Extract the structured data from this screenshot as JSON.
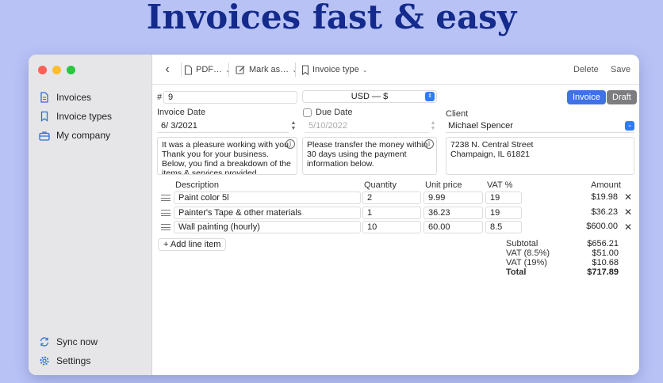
{
  "headline": "Invoices fast & easy",
  "sidebar": {
    "items": [
      {
        "label": "Invoices",
        "icon": "document-icon"
      },
      {
        "label": "Invoice types",
        "icon": "bookmark-icon"
      },
      {
        "label": "My company",
        "icon": "briefcase-icon"
      }
    ],
    "bottom": [
      {
        "label": "Sync now",
        "icon": "sync-icon"
      },
      {
        "label": "Settings",
        "icon": "gear-icon"
      }
    ]
  },
  "toolbar": {
    "pdf_label": "PDF…",
    "mark_label": "Mark as…",
    "type_label": "Invoice type",
    "delete_label": "Delete",
    "save_label": "Save"
  },
  "form": {
    "number_prefix": "#",
    "number": "9",
    "currency": "USD — $",
    "invoice_btn": "Invoice",
    "draft_btn": "Draft",
    "invoice_date_label": "Invoice Date",
    "invoice_date": "6/  3/2021",
    "due_date_label": "Due Date",
    "due_date": "5/10/2022",
    "client_label": "Client",
    "client": "Michael Spencer",
    "intro_text": "It was a pleasure working with you. Thank you for your business.\nBelow, you find a breakdown of the items & services provided.",
    "payment_text": "Please transfer the money within 30 days using the payment information below.",
    "client_address": "7238 N. Central Street\nChampaign, IL 61821"
  },
  "table": {
    "headers": {
      "description": "Description",
      "quantity": "Quantity",
      "unit_price": "Unit price",
      "vat": "VAT %",
      "amount": "Amount"
    },
    "rows": [
      {
        "description": "Paint color 5l",
        "quantity": "2",
        "unit_price": "9.99",
        "vat": "19",
        "amount": "$19.98"
      },
      {
        "description": "Painter's Tape & other materials",
        "quantity": "1",
        "unit_price": "36.23",
        "vat": "19",
        "amount": "$36.23"
      },
      {
        "description": "Wall painting (hourly)",
        "quantity": "10",
        "unit_price": "60.00",
        "vat": "8.5",
        "amount": "$600.00"
      }
    ],
    "add_line_label": "Add line item"
  },
  "totals": {
    "subtotal_label": "Subtotal",
    "subtotal": "$656.21",
    "vat1_label": "VAT (8.5%)",
    "vat1": "$51.00",
    "vat2_label": "VAT (19%)",
    "vat2": "$10.68",
    "total_label": "Total",
    "total": "$717.89"
  },
  "colors": {
    "background": "#b8c2f5",
    "headline": "#142a8c",
    "accent": "#3f72e6",
    "draft": "#7d7d80"
  }
}
